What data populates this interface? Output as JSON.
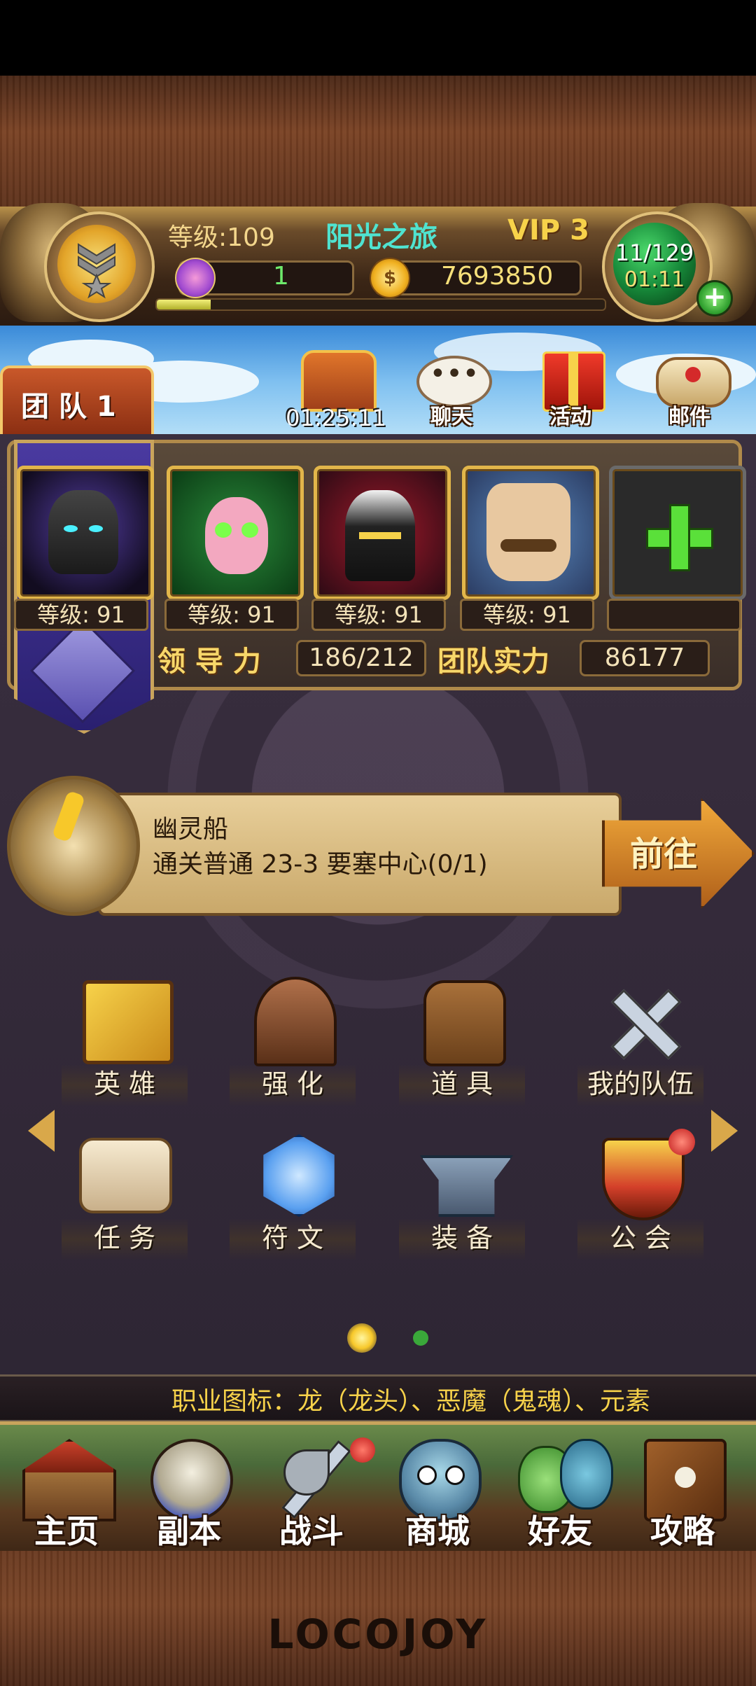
{
  "player": {
    "level_text": "等级:109",
    "name": "阳光之旅",
    "vip": "VIP 3",
    "gems": "1",
    "gold": "7693850",
    "stamina": "11/129",
    "stamina_timer": "01:11",
    "exp_progress": 0.12
  },
  "top_buttons": {
    "chest_timer": "01:25:11",
    "chat": "聊天",
    "events": "活动",
    "mail": "邮件"
  },
  "team": {
    "tab_label": "团 队 1",
    "heroes": [
      {
        "level": "等级: 91",
        "icon": "dark-knight-portrait"
      },
      {
        "level": "等级: 91",
        "icon": "green-eyed-elf-portrait"
      },
      {
        "level": "等级: 91",
        "icon": "masked-assassin-portrait"
      },
      {
        "level": "等级: 91",
        "icon": "mustache-man-portrait"
      }
    ],
    "leadership_label": "领 导 力",
    "leadership_value": "186/212",
    "power_label": "团队实力",
    "power_value": "86177"
  },
  "quest": {
    "title": "幽灵船",
    "desc": "通关普通 23-3 要塞中心(0/1)",
    "go_label": "前往"
  },
  "menu": [
    {
      "label": "英 雄",
      "icon": "hero-book-icon"
    },
    {
      "label": "强 化",
      "icon": "forge-furnace-icon"
    },
    {
      "label": "道 具",
      "icon": "backpack-icon"
    },
    {
      "label": "我的队伍",
      "icon": "crossed-swords-icon"
    },
    {
      "label": "任 务",
      "icon": "scroll-icon"
    },
    {
      "label": "符 文",
      "icon": "rune-gem-icon"
    },
    {
      "label": "装 备",
      "icon": "anvil-icon"
    },
    {
      "label": "公 会",
      "icon": "guild-shield-icon"
    }
  ],
  "page_indicator": {
    "current": 1,
    "total": 2
  },
  "ticker": "职业图标：龙（龙头）、恶魔（鬼魂）、元素",
  "nav": [
    {
      "label": "主页",
      "icon": "house-icon"
    },
    {
      "label": "副本",
      "icon": "skull-icon"
    },
    {
      "label": "战斗",
      "icon": "axe-sword-icon"
    },
    {
      "label": "商城",
      "icon": "monster-shop-icon"
    },
    {
      "label": "好友",
      "icon": "friends-icon"
    },
    {
      "label": "攻略",
      "icon": "guide-book-icon"
    }
  ],
  "brand": "LOCOJOY",
  "colors": {
    "gold": "#f3d68c",
    "green": "#6ee96b",
    "purple": "#3a3040"
  }
}
